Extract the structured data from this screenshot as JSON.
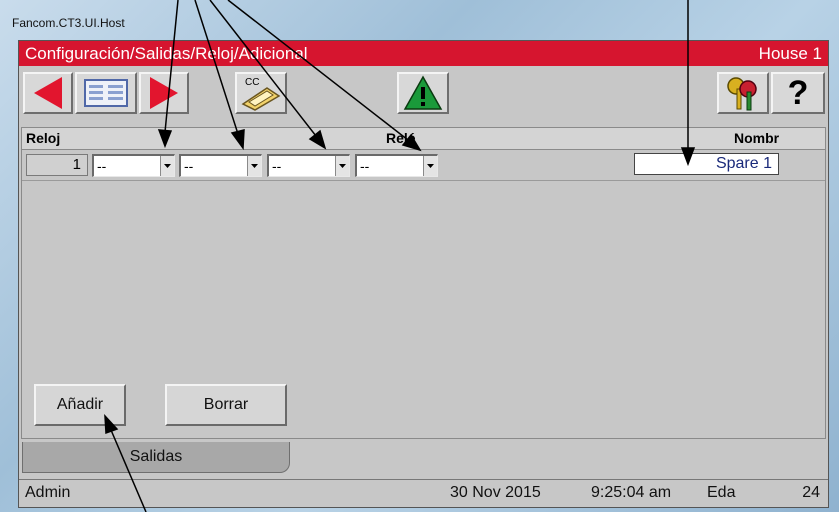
{
  "window": {
    "title": "Fancom.CT3.UI.Host"
  },
  "header": {
    "title": "Configuración/Salidas/Reloj/Adicional",
    "location": "House 1"
  },
  "toolbar": {
    "back_icon": "left-arrow-icon",
    "menu_icon": "card-menu-icon",
    "forward_icon": "right-arrow-icon",
    "copy_label": "CC",
    "copy_icon": "copy-config-icon",
    "alarm_icon": "warning-icon",
    "keys_icon": "keys-icon",
    "help_label": "?"
  },
  "grid": {
    "headers": {
      "reloj": "Reloj",
      "rele": "Relé",
      "nombre": "Nombr"
    },
    "rows": [
      {
        "number": "1",
        "relays": [
          "--",
          "--",
          "--",
          "--"
        ],
        "name": "Spare 1"
      }
    ]
  },
  "buttons": {
    "add": "Añadir",
    "delete": "Borrar"
  },
  "tabs": [
    {
      "label": "Salidas"
    }
  ],
  "status": {
    "user": "Admin",
    "date": "30 Nov 2015",
    "time": "9:25:04 am",
    "mode": "Eda",
    "number": "24"
  },
  "colors": {
    "header": "#d6152f",
    "nav_arrows": "#e2152e",
    "alarm": "#1a9a3a"
  }
}
